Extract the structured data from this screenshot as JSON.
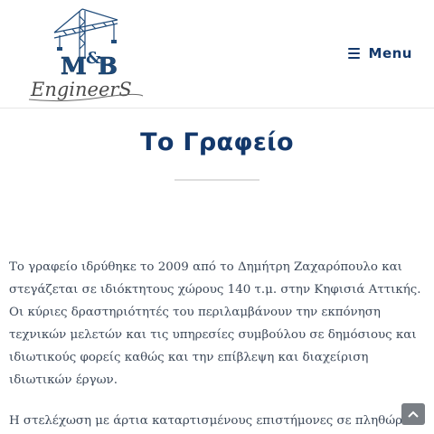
{
  "header": {
    "logo": {
      "brand": "M&B",
      "tagline": "EngineerS"
    },
    "menu_label": "Menu"
  },
  "page": {
    "title": "Το Γραφείο"
  },
  "content": {
    "paragraph_1": "Το γραφείο ιδρύθηκε το 2009 από το Δημήτρη Ζαχαρόπουλο και στεγάζεται σε ιδιόκτητους χώρους 140 τ.μ. στην Κηφισιά Αττικής. Οι κύριες δραστηριότητές του περιλαμβάνουν την εκπόνηση τεχνικών μελετών και τις υπηρεσίες συμβούλου σε δημόσιους και ιδιωτικούς φορείς καθώς και την επίβλεψη και διαχείριση ιδιωτικών έργων.",
    "paragraph_2": "Η στελέχωση με άρτια καταρτισμένους επιστήμονες σε πληθώρα"
  },
  "icons": {
    "menu": "hamburger-icon",
    "scroll_top": "chevron-up-icon"
  },
  "colors": {
    "brand_navy": "#13386b",
    "text": "#3c4858",
    "scroll_button": "#7a7f85"
  }
}
